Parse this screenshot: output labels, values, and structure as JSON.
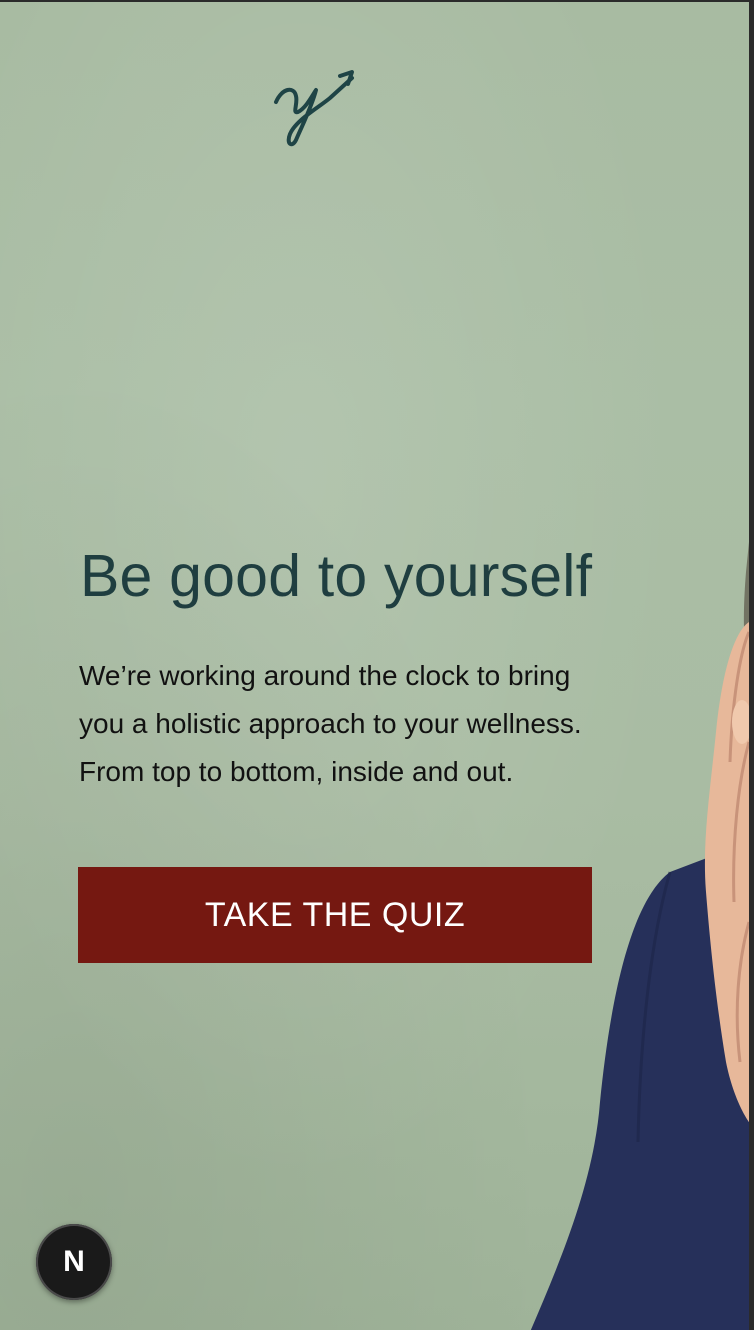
{
  "hero": {
    "headline": "Be good to yourself",
    "body_line_1": "We’re working around the clock to bring",
    "body_line_2": "you a holistic approach to your wellness.",
    "body_line_3": "From top to bottom, inside and out.",
    "cta_label": "TAKE THE QUIZ"
  },
  "dev_badge": {
    "label": "N"
  },
  "icons": {
    "logo": "signature-arrow-logo-icon",
    "dev_badge": "nextjs-icon"
  },
  "colors": {
    "background": "#a9bca3",
    "headline": "#1f3e40",
    "body_text": "#111111",
    "cta_background": "#751811",
    "cta_text": "#ffffff",
    "sweater": "#26305a"
  }
}
